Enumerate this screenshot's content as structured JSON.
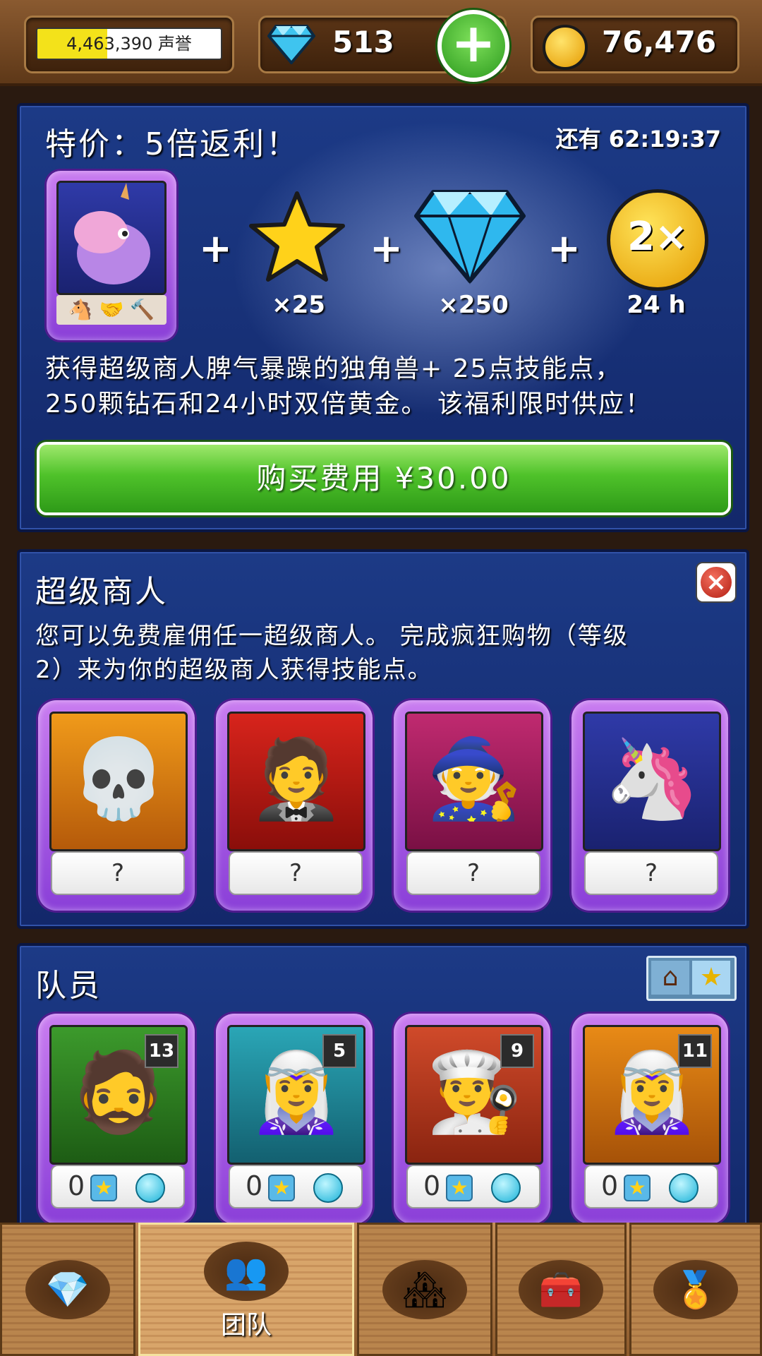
{
  "header": {
    "reputation": {
      "text": "4,463,390 声誉",
      "fill": 0.38
    },
    "gems": "513",
    "coins": "76,476"
  },
  "offer": {
    "title": "特价：5倍返利！",
    "timer": "还有 62:19:37",
    "stars": "×25",
    "gems": "×250",
    "gold_boost": "24 h",
    "boost_badge": "2×",
    "plus": "+",
    "description_line1": "获得超级商人脾气暴躁的独角兽+ 25点技能点，",
    "description_line2": "250颗钻石和24小时双倍黄金。 该福利限时供应！",
    "buy_label": "购买费用 ¥30.00"
  },
  "super_merchants": {
    "title": "超级商人",
    "desc_line1": "您可以免费雇佣任一超级商人。 完成疯狂购物（等级",
    "desc_line2": "2）来为你的超级商人获得技能点。",
    "cards": [
      {
        "name": "skeleton",
        "label": "?"
      },
      {
        "name": "gentleman",
        "label": "?"
      },
      {
        "name": "sage",
        "label": "?"
      },
      {
        "name": "unicorn",
        "label": "?"
      }
    ]
  },
  "team": {
    "title": "队员",
    "members": [
      {
        "name": "wizard",
        "level": "13",
        "points": "0"
      },
      {
        "name": "elf-alchemist",
        "level": "5",
        "points": "0"
      },
      {
        "name": "chef",
        "level": "9",
        "points": "0"
      },
      {
        "name": "elf-artist",
        "level": "11",
        "points": "0"
      }
    ]
  },
  "nav": {
    "active_label": "团队"
  },
  "colors": {
    "panel": "#1c3a86",
    "buy_button": "#4fc22a",
    "card": "#a35be2"
  }
}
